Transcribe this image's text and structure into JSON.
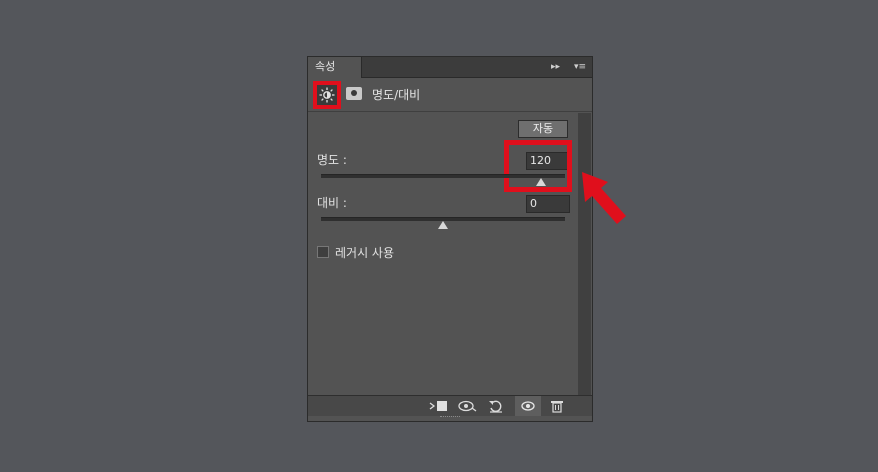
{
  "panel": {
    "tab_label": "속성",
    "tab_controls": "▸▸",
    "menu_icon": "▾≡"
  },
  "header": {
    "title": "명도/대비",
    "adjustment_icon": "sun-icon",
    "mask_icon": "mask-icon"
  },
  "controls": {
    "auto_label": "자동",
    "brightness": {
      "label": "명도 :",
      "value": "120",
      "level_fraction": 0.9
    },
    "contrast": {
      "label": "대비 :",
      "value": "0",
      "level_fraction": 0.5
    },
    "legacy_label": "레거시 사용",
    "legacy_checked": false
  },
  "footer": {
    "icons": [
      "clip-to-layer-icon",
      "view-previous-icon",
      "reset-icon",
      "visibility-icon",
      "trash-icon"
    ]
  },
  "colors": {
    "highlight": "#e00f1c",
    "panel": "#535353",
    "background": "#54565b"
  }
}
